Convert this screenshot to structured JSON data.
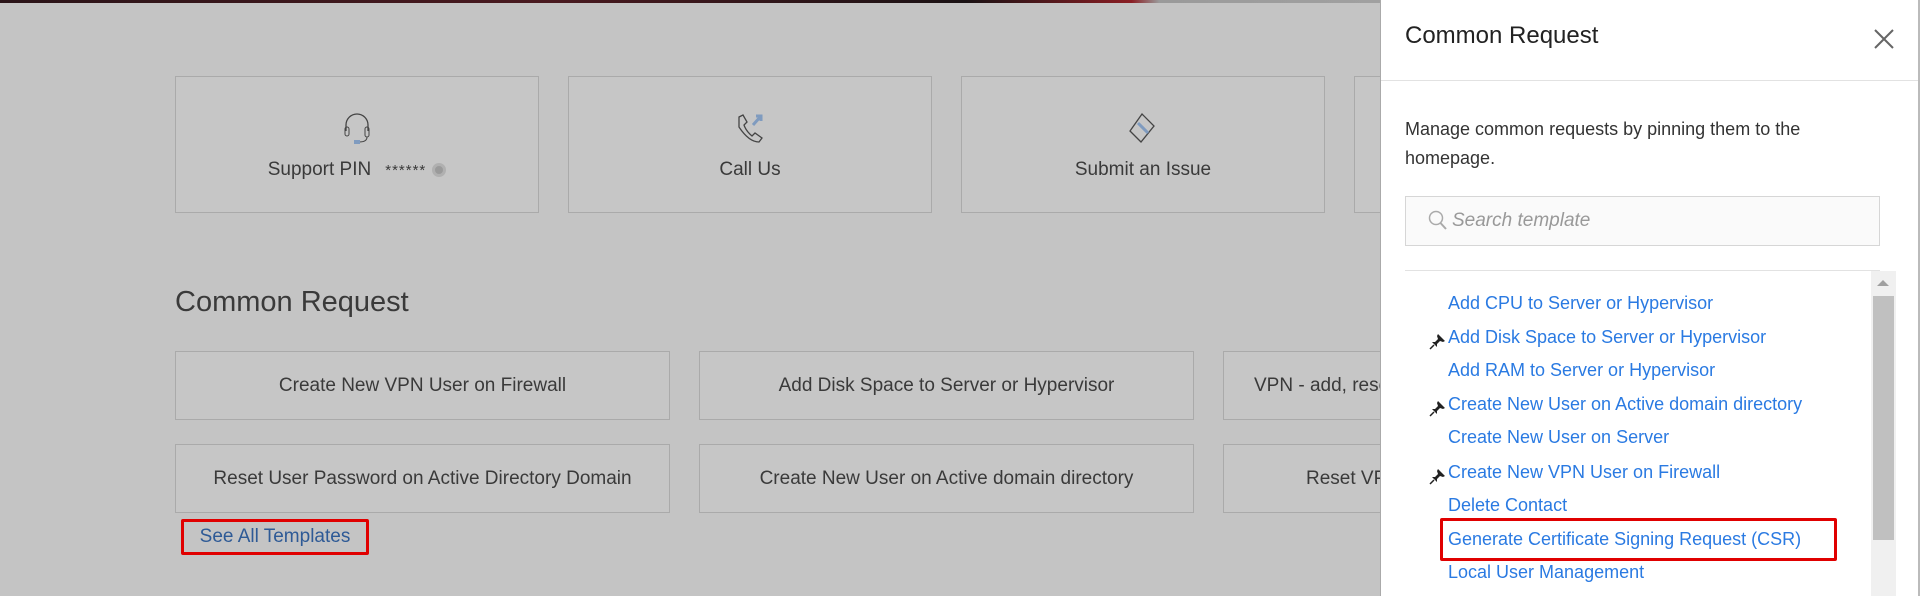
{
  "cards": [
    {
      "label": "Support PIN",
      "pin": "******",
      "icon": "headset-icon"
    },
    {
      "label": "Call Us",
      "icon": "phone-icon"
    },
    {
      "label": "Submit an Issue",
      "icon": "ticket-icon"
    }
  ],
  "main": {
    "heading": "Common Request",
    "requests": [
      "Create New VPN User on Firewall",
      "Add Disk Space to Server or Hypervisor",
      "VPN - add, reset",
      "Reset User Password on Active Directory Domain",
      "Create New User on Active domain directory",
      "Reset VPN"
    ],
    "see_all": "See All Templates"
  },
  "panel": {
    "title": "Common Request",
    "description": "Manage common requests by pinning them to the homepage.",
    "search_placeholder": "Search template",
    "items": [
      {
        "label": "Add CPU to Server or Hypervisor",
        "pinned": false
      },
      {
        "label": "Add Disk Space to Server or Hypervisor",
        "pinned": true
      },
      {
        "label": "Add RAM to Server or Hypervisor",
        "pinned": false
      },
      {
        "label": "Create New User on Active domain directory",
        "pinned": true
      },
      {
        "label": "Create New User on Server",
        "pinned": false
      },
      {
        "label": "Create New VPN User on Firewall",
        "pinned": true
      },
      {
        "label": "Delete Contact",
        "pinned": false
      },
      {
        "label": "Generate Certificate Signing Request (CSR)",
        "pinned": false
      },
      {
        "label": "Local User Management",
        "pinned": false
      }
    ]
  },
  "colors": {
    "link": "#2a7ae2",
    "highlight": "#e00000"
  }
}
